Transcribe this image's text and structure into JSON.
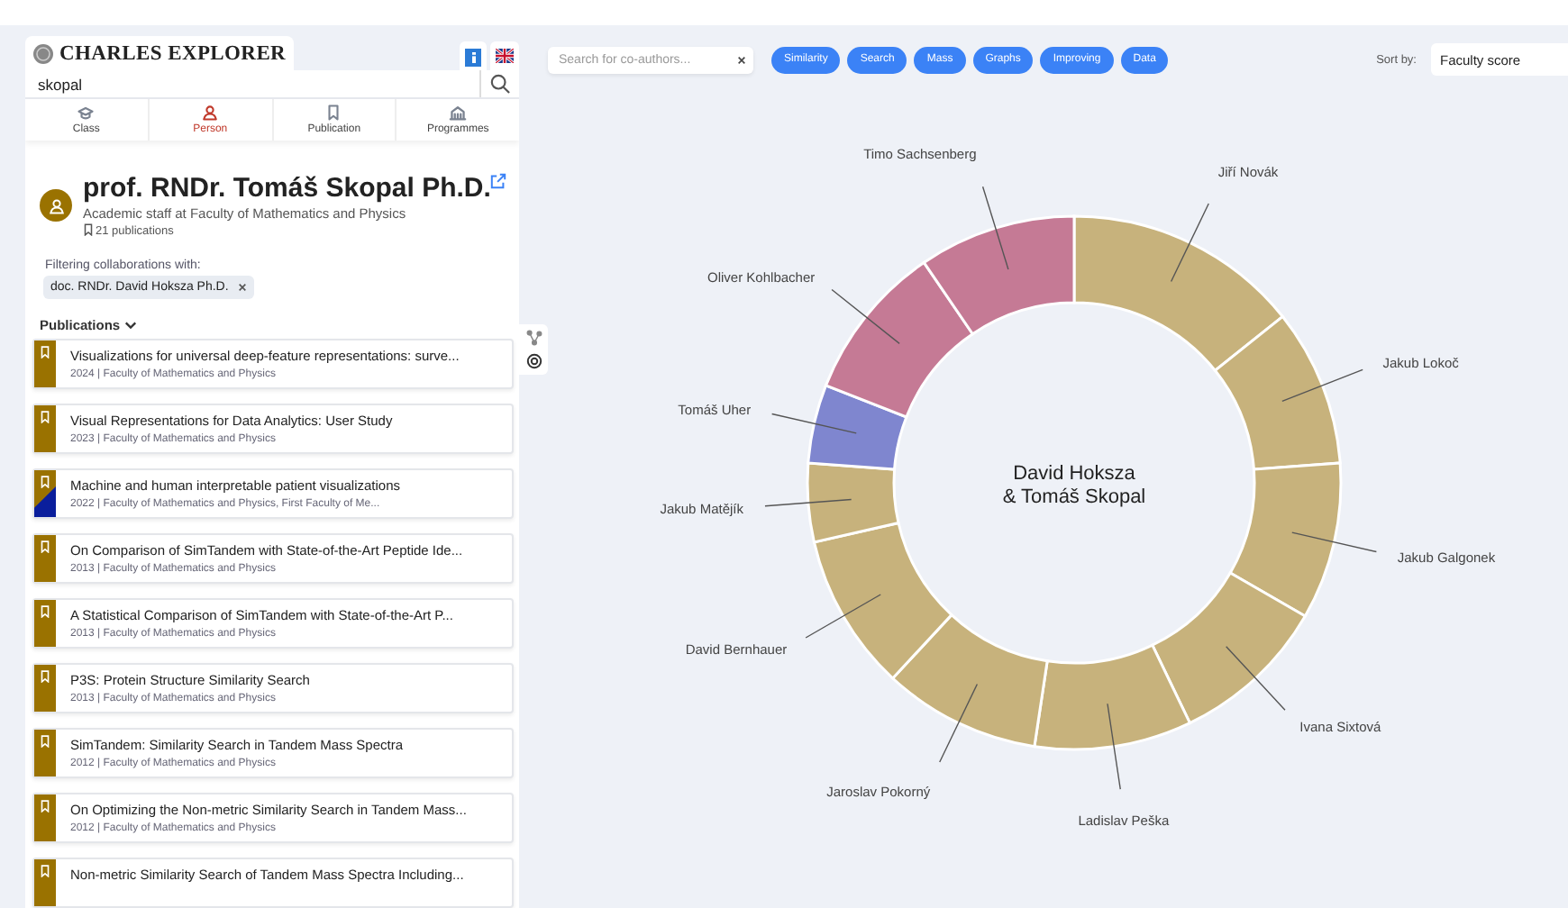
{
  "brand": {
    "title": "CHARLES EXPLORER"
  },
  "search": {
    "value": "skopal"
  },
  "categories": [
    {
      "label": "Class",
      "kind": "cap",
      "selected": false
    },
    {
      "label": "Person",
      "kind": "person",
      "selected": true
    },
    {
      "label": "Publication",
      "kind": "bookmark",
      "selected": false
    },
    {
      "label": "Programmes",
      "kind": "building",
      "selected": false
    }
  ],
  "profile": {
    "name": "prof. RNDr. Tomáš Skopal Ph.D.",
    "role": "Academic staff at Faculty of Mathematics and Physics",
    "publications": "21 publications",
    "filter_label": "Filtering collaborations with:",
    "filter_chip": "doc. RNDr. David Hoksza Ph.D."
  },
  "publications_heading": "Publications",
  "publications": [
    {
      "title": "Visualizations for universal deep-feature representations: surve...",
      "meta": "2024 | Faculty of Mathematics and Physics",
      "color": "#9a7200"
    },
    {
      "title": "Visual Representations for Data Analytics: User Study",
      "meta": "2023 | Faculty of Mathematics and Physics",
      "color": "#9a7200"
    },
    {
      "title": "Machine and human interpretable patient visualizations",
      "meta": "2022 | Faculty of Mathematics and Physics, First Faculty of Me...",
      "color": "#9a7200",
      "accent": {
        "color": "#0a1e9c"
      }
    },
    {
      "title": "On Comparison of SimTandem with State-of-the-Art Peptide Ide...",
      "meta": "2013 | Faculty of Mathematics and Physics",
      "color": "#9a7200"
    },
    {
      "title": "A Statistical Comparison of SimTandem with State-of-the-Art P...",
      "meta": "2013 | Faculty of Mathematics and Physics",
      "color": "#9a7200"
    },
    {
      "title": "P3S: Protein Structure Similarity Search",
      "meta": "2013 | Faculty of Mathematics and Physics",
      "color": "#9a7200"
    },
    {
      "title": "SimTandem: Similarity Search in Tandem Mass Spectra",
      "meta": "2012 | Faculty of Mathematics and Physics",
      "color": "#9a7200"
    },
    {
      "title": "On Optimizing the Non-metric Similarity Search in Tandem Mass...",
      "meta": "2012 | Faculty of Mathematics and Physics",
      "color": "#9a7200"
    },
    {
      "title": "Non-metric Similarity Search of Tandem Mass Spectra Including...",
      "color": "#9a7200"
    }
  ],
  "coauthor_search": {
    "placeholder": "Search for co-authors..."
  },
  "keywords": [
    "Similarity",
    "Search",
    "Mass",
    "Graphs",
    "Improving",
    "Data"
  ],
  "sort": {
    "label": "Sort by:",
    "value": "Faculty score"
  },
  "chart": {
    "center_lines": [
      "David Hoksza",
      "& Tomáš Skopal"
    ],
    "right_collaborators": [
      {
        "name": "Jiří Novák",
        "color": "#c7b27c"
      },
      {
        "name": "Jakub Lokoč",
        "color": "#c7b27c"
      },
      {
        "name": "Jakub Galgonek",
        "color": "#c7b27c"
      },
      {
        "name": "Ivana Sixtová",
        "color": "#c7b27c"
      },
      {
        "name": "Ladislav Peška",
        "color": "#c7b27c"
      }
    ],
    "left_collaborators": [
      {
        "name": "Timo Sachsenberg",
        "color": "#c57a95"
      },
      {
        "name": "Oliver Kohlbacher",
        "color": "#c57a95"
      },
      {
        "name": "Tomáš Uher",
        "color": "#7f86cf"
      },
      {
        "name": "Jakub Matějík",
        "color": "#c7b27c"
      },
      {
        "name": "David Bernhauer",
        "color": "#c7b27c"
      },
      {
        "name": "Jaroslav Pokorný",
        "color": "#c7b27c"
      }
    ]
  }
}
